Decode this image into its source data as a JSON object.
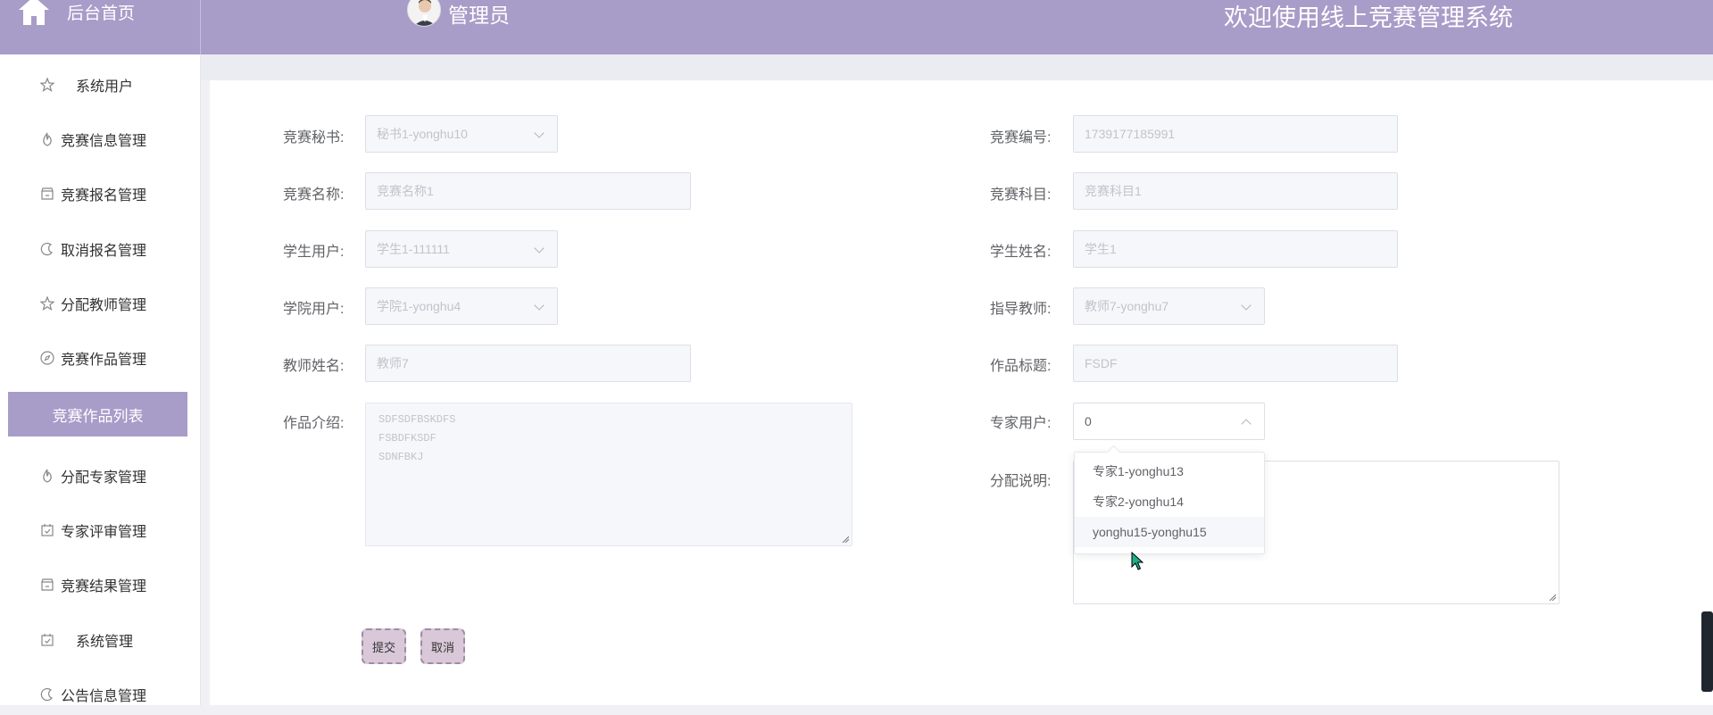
{
  "header": {
    "home_label": "后台首页",
    "admin_name": "管理员",
    "welcome": "欢迎使用线上竞赛管理系统",
    "color": "#a89cc8"
  },
  "sidebar": {
    "items": [
      {
        "label": "系统用户",
        "icon": "star-icon"
      },
      {
        "label": "竞赛信息管理",
        "icon": "fire-icon"
      },
      {
        "label": "竞赛报名管理",
        "icon": "shop-icon"
      },
      {
        "label": "取消报名管理",
        "icon": "moon-icon"
      },
      {
        "label": "分配教师管理",
        "icon": "star-icon"
      },
      {
        "label": "竞赛作品管理",
        "icon": "compass-icon"
      },
      {
        "label": "竞赛作品列表",
        "active": true
      },
      {
        "label": "分配专家管理",
        "icon": "fire-icon"
      },
      {
        "label": "专家评审管理",
        "icon": "calendar-check-icon"
      },
      {
        "label": "竞赛结果管理",
        "icon": "shop-icon"
      },
      {
        "label": "系统管理",
        "icon": "calendar-check-icon"
      },
      {
        "label": "公告信息管理",
        "icon": "moon-icon"
      }
    ]
  },
  "form": {
    "secretary": {
      "label": "竞赛秘书:",
      "value": "秘书1-yonghu10"
    },
    "comp_no": {
      "label": "竞赛编号:",
      "value": "1739177185991"
    },
    "comp_name": {
      "label": "竞赛名称:",
      "value": "竞赛名称1"
    },
    "comp_subject": {
      "label": "竞赛科目:",
      "value": "竞赛科目1"
    },
    "student_user": {
      "label": "学生用户:",
      "value": "学生1-111111"
    },
    "student_name": {
      "label": "学生姓名:",
      "value": "学生1"
    },
    "college_user": {
      "label": "学院用户:",
      "value": "学院1-yonghu4"
    },
    "advisor": {
      "label": "指导教师:",
      "value": "教师7-yonghu7"
    },
    "teacher_name": {
      "label": "教师姓名:",
      "value": "教师7"
    },
    "work_title": {
      "label": "作品标题:",
      "value": "FSDF"
    },
    "work_intro": {
      "label": "作品介绍:",
      "lines": [
        "SDFSDFBSKDFS",
        "FSBDFKSDF",
        "SDNFBKJ"
      ]
    },
    "expert_user": {
      "label": "专家用户:",
      "value": "0"
    },
    "assign_note": {
      "label": "分配说明:",
      "value": ""
    },
    "expert_options": [
      "专家1-yonghu13",
      "专家2-yonghu14",
      "yonghu15-yonghu15"
    ],
    "submit_label": "提交",
    "cancel_label": "取消"
  }
}
